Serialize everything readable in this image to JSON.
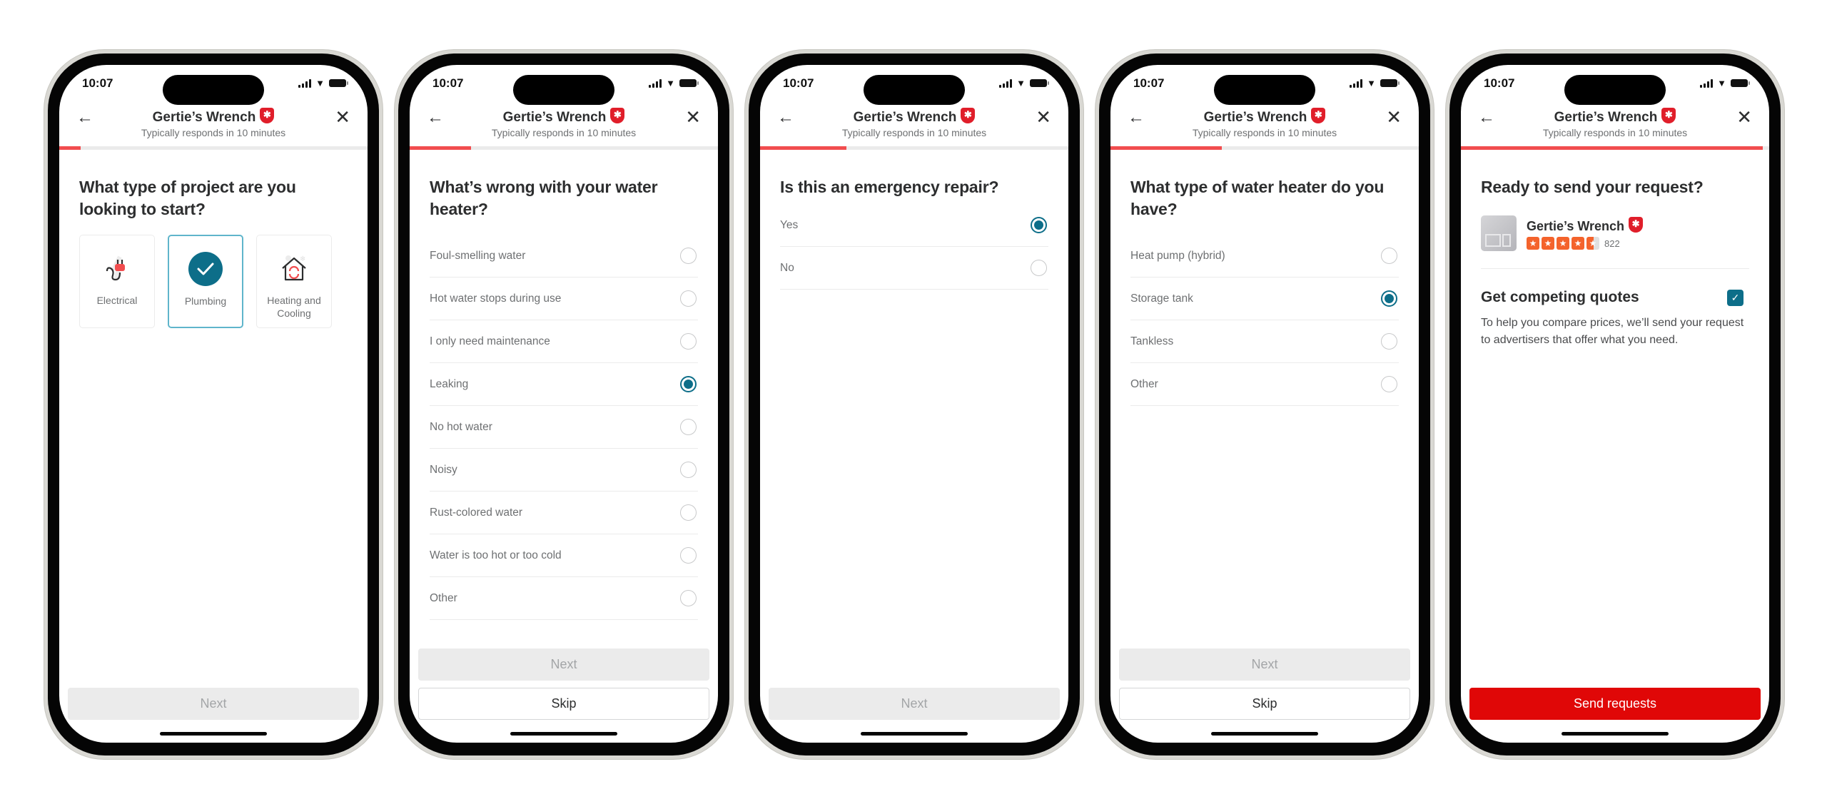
{
  "status_bar": {
    "time": "10:07"
  },
  "header": {
    "business_name": "Gertie’s Wrench",
    "responds": "Typically responds in 10 minutes",
    "back_icon": "arrow-left-icon",
    "close_icon": "close-icon"
  },
  "screens": [
    {
      "progress_percent": 7,
      "question": "What type of project are you looking to start?",
      "tiles": [
        {
          "label": "Electrical",
          "icon": "plug-icon",
          "selected": false
        },
        {
          "label": "Plumbing",
          "icon": "check-circle-icon",
          "selected": true
        },
        {
          "label": "Heating and Cooling",
          "icon": "house-hvac-icon",
          "selected": false
        }
      ],
      "next_label": "Next"
    },
    {
      "progress_percent": 20,
      "question": "What’s wrong with your water heater?",
      "options": [
        {
          "label": "Foul-smelling water",
          "selected": false
        },
        {
          "label": "Hot water stops during use",
          "selected": false
        },
        {
          "label": "I only need maintenance",
          "selected": false
        },
        {
          "label": "Leaking",
          "selected": true
        },
        {
          "label": "No hot water",
          "selected": false
        },
        {
          "label": "Noisy",
          "selected": false
        },
        {
          "label": "Rust-colored water",
          "selected": false
        },
        {
          "label": "Water is too hot or too cold",
          "selected": false
        },
        {
          "label": "Other",
          "selected": false
        }
      ],
      "next_label": "Next",
      "skip_label": "Skip"
    },
    {
      "progress_percent": 28,
      "question": "Is this an emergency repair?",
      "options": [
        {
          "label": "Yes",
          "selected": true
        },
        {
          "label": "No",
          "selected": false
        }
      ],
      "next_label": "Next"
    },
    {
      "progress_percent": 36,
      "question": "What type of water heater do you have?",
      "options": [
        {
          "label": "Heat pump (hybrid)",
          "selected": false
        },
        {
          "label": "Storage tank",
          "selected": true
        },
        {
          "label": "Tankless",
          "selected": false
        },
        {
          "label": "Other",
          "selected": false
        }
      ],
      "next_label": "Next",
      "skip_label": "Skip"
    },
    {
      "progress_percent": 98,
      "question": "Ready to send your request?",
      "business": {
        "name": "Gertie’s Wrench",
        "rating": 4.5,
        "review_count": "822"
      },
      "quotes_title": "Get competing quotes",
      "quotes_checked": true,
      "quotes_text": "To help you compare prices, we’ll send your request to advertisers that offer what you need.",
      "send_label": "Send requests"
    }
  ],
  "colors": {
    "accent_red": "#e00707",
    "progress_red": "#f14d4f",
    "selected_teal": "#0d6e89",
    "tile_selected_border": "#5fb5cb",
    "star_orange": "#f4632c"
  }
}
